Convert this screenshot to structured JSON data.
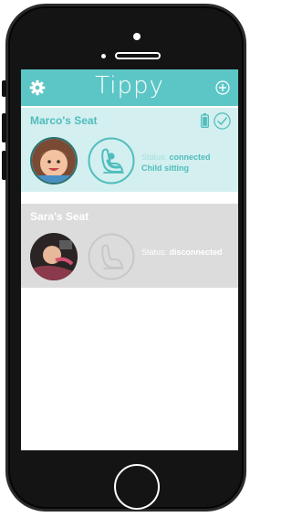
{
  "app": {
    "title": "Tippy"
  },
  "seats": [
    {
      "name": "Marco's Seat",
      "status_label": "Status:",
      "status_value": "connected",
      "child_status": "Child sitting"
    },
    {
      "name": "Sara's Seat",
      "status_label": "Status:",
      "status_value": "disconnected"
    }
  ],
  "icons": {
    "settings": "gear-icon",
    "add": "plus-circle-icon",
    "battery": "battery-icon",
    "check": "check-circle-icon",
    "seat": "car-seat-icon"
  },
  "colors": {
    "brand": "#5cc6c6",
    "connected_card": "#d3efef",
    "disconnected_card": "#dcdcdc"
  }
}
